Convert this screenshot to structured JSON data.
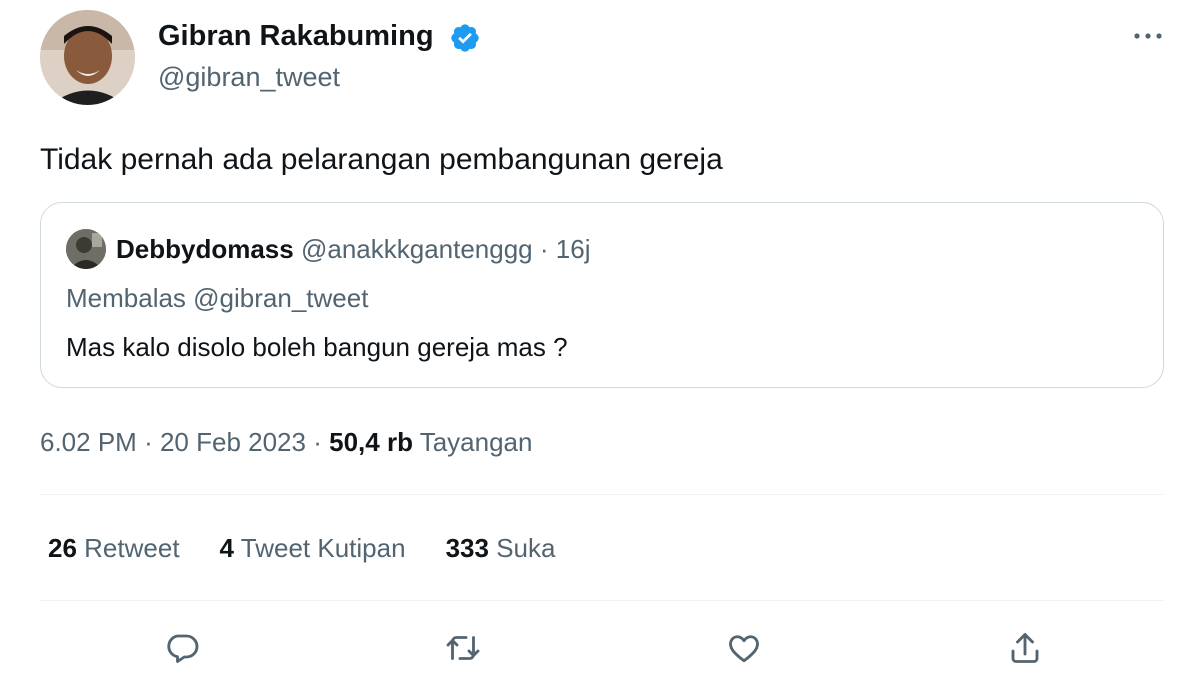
{
  "tweet": {
    "author": {
      "display_name": "Gibran Rakabuming",
      "handle": "@gibran_tweet",
      "verified_icon": "verified-badge-icon",
      "avatar_icon": "profile-avatar"
    },
    "more_icon": "more-horizontal-icon",
    "text": "Tidak pernah ada pelarangan pembangunan gereja",
    "quoted": {
      "display_name": "Debbydomass",
      "handle": "@anakkkgantenggg",
      "separator": "·",
      "time": "16j",
      "replying_to": "Membalas @gibran_tweet",
      "text": "Mas kalo disolo boleh bangun gereja mas ?"
    },
    "meta": {
      "time": "6.02 PM",
      "separator1": "·",
      "date": "20 Feb 2023",
      "separator2": "·",
      "views_count": "50,4 rb",
      "views_label": "Tayangan"
    },
    "stats": [
      {
        "count": "26",
        "label": "Retweet"
      },
      {
        "count": "4",
        "label": "Tweet Kutipan"
      },
      {
        "count": "333",
        "label": "Suka"
      }
    ],
    "actions": [
      {
        "icon": "reply-icon"
      },
      {
        "icon": "retweet-icon"
      },
      {
        "icon": "like-heart-icon"
      },
      {
        "icon": "share-icon"
      }
    ]
  },
  "colors": {
    "text_primary": "#0f1419",
    "text_secondary": "#536471",
    "verified_blue": "#1d9bf0",
    "border": "#cfd9de"
  }
}
